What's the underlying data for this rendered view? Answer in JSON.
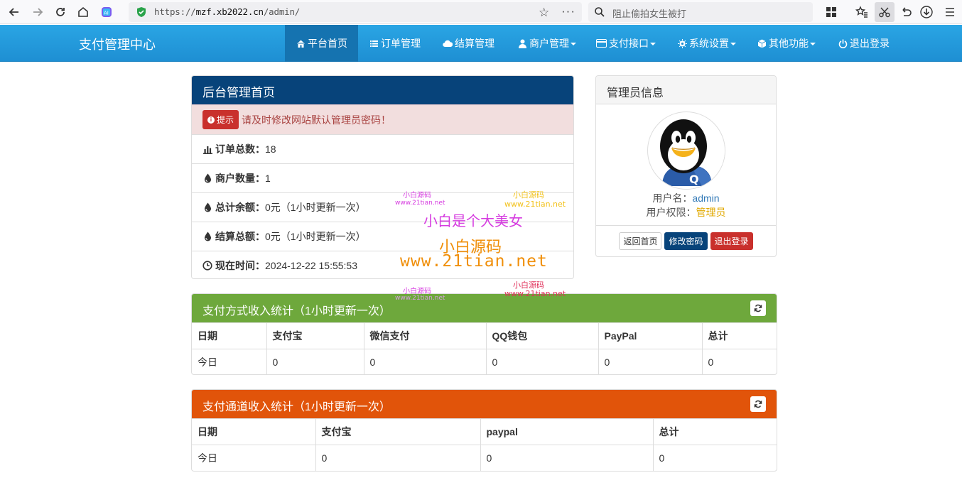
{
  "browser": {
    "url_scheme": "https://",
    "url_host": "mzf.xb2022.cn",
    "url_path": "/admin/",
    "search_placeholder": "阻止偷拍女生被打"
  },
  "navbar": {
    "brand": "支付管理中心",
    "items": [
      {
        "label": "平台首页",
        "icon": "home-icon",
        "active": true
      },
      {
        "label": "订单管理",
        "icon": "list-icon"
      },
      {
        "label": "结算管理",
        "icon": "cloud-icon"
      },
      {
        "label": "商户管理",
        "icon": "user-icon",
        "dropdown": true
      },
      {
        "label": "支付接口",
        "icon": "credit-card-icon",
        "dropdown": true
      },
      {
        "label": "系统设置",
        "icon": "gear-icon",
        "dropdown": true
      },
      {
        "label": "其他功能",
        "icon": "cube-icon",
        "dropdown": true
      },
      {
        "label": "退出登录",
        "icon": "power-icon"
      }
    ]
  },
  "home_panel": {
    "title": "后台管理首页",
    "alert_tag": "提示",
    "alert_text": "请及时修改网站默认管理员密码！",
    "rows": [
      {
        "label": "订单总数：",
        "value": "18",
        "icon": "bar-chart-icon"
      },
      {
        "label": "商户数量：",
        "value": "1",
        "icon": "tint-icon"
      },
      {
        "label": "总计余额：",
        "value": "0元（1小时更新一次）",
        "icon": "tint-icon"
      },
      {
        "label": "结算总额：",
        "value": "0元（1小时更新一次）",
        "icon": "tint-icon"
      },
      {
        "label": "现在时间：",
        "value": " 2024-12-22 15:55:53",
        "icon": "clock-icon"
      }
    ]
  },
  "admin_panel": {
    "title": "管理员信息",
    "username_label": "用户名：",
    "username": "admin",
    "role_label": "用户权限：",
    "role": "管理员",
    "buttons": [
      "返回首页",
      "修改密码",
      "退出登录"
    ]
  },
  "pay_method_stats": {
    "title": "支付方式收入统计（1小时更新一次）",
    "headers": [
      "日期",
      "支付宝",
      "微信支付",
      "QQ钱包",
      "PayPal",
      "总计"
    ],
    "rows": [
      [
        "今日",
        "0",
        "0",
        "0",
        "0",
        "0"
      ]
    ]
  },
  "pay_channel_stats": {
    "title": "支付通道收入统计（1小时更新一次）",
    "headers": [
      "日期",
      "支付宝",
      "paypal",
      "总计"
    ],
    "rows": [
      [
        "今日",
        "0",
        "0",
        "0"
      ]
    ]
  },
  "watermark": {
    "small_a": "小白源码",
    "small_a_url": "www.21tian.net",
    "small_b": "小白源码",
    "small_b_url": "www.21tian.net",
    "big_line1": "小白是个大美女",
    "big_line2": "小白源码",
    "big_line3": "www.21tian.net"
  },
  "colors": {
    "navbar": "#1e8fd3",
    "dark_header": "#07437a",
    "green_header": "#6ea83c",
    "orange_header": "#e1540a",
    "danger": "#c9302c"
  }
}
